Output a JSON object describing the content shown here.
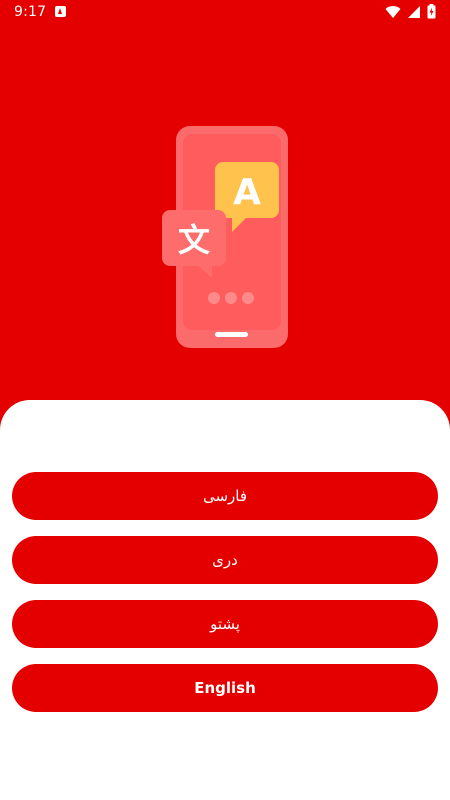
{
  "status_bar": {
    "time": "9:17",
    "icons": [
      "notification-app-icon",
      "wifi-icon",
      "signal-icon",
      "battery-charging-icon"
    ]
  },
  "hero": {
    "illustration": "translate-phone-illustration",
    "bubble_left_glyph": "文",
    "bubble_right_glyph": "A",
    "colors": {
      "background": "#e50000",
      "phone": "#fc6b6b",
      "phone_screen": "#ff5d5d",
      "bubble_left": "#ff6c6c",
      "bubble_right": "#ffc34d"
    }
  },
  "languages": [
    {
      "label": "فارسی"
    },
    {
      "label": "دری"
    },
    {
      "label": "پشتو"
    },
    {
      "label": "English"
    }
  ],
  "colors": {
    "accent": "#e50000",
    "sheet": "#ffffff",
    "button_text": "#ffffff"
  }
}
